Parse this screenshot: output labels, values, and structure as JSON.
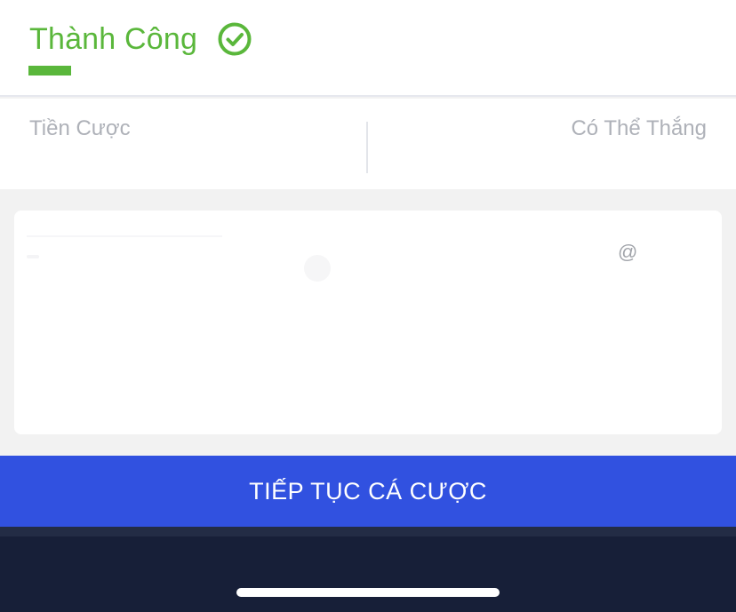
{
  "header": {
    "title": "Thành Công",
    "status_icon": "check-circle-icon",
    "accent_color": "#5ab73b"
  },
  "stats": {
    "stake_label": "Tiền Cược",
    "potential_win_label": "Có Thể Thắng"
  },
  "card": {
    "symbol": "@"
  },
  "actions": {
    "continue_label": "TIẾP TỤC CÁ CƯỢC",
    "continue_color": "#3151e0"
  }
}
